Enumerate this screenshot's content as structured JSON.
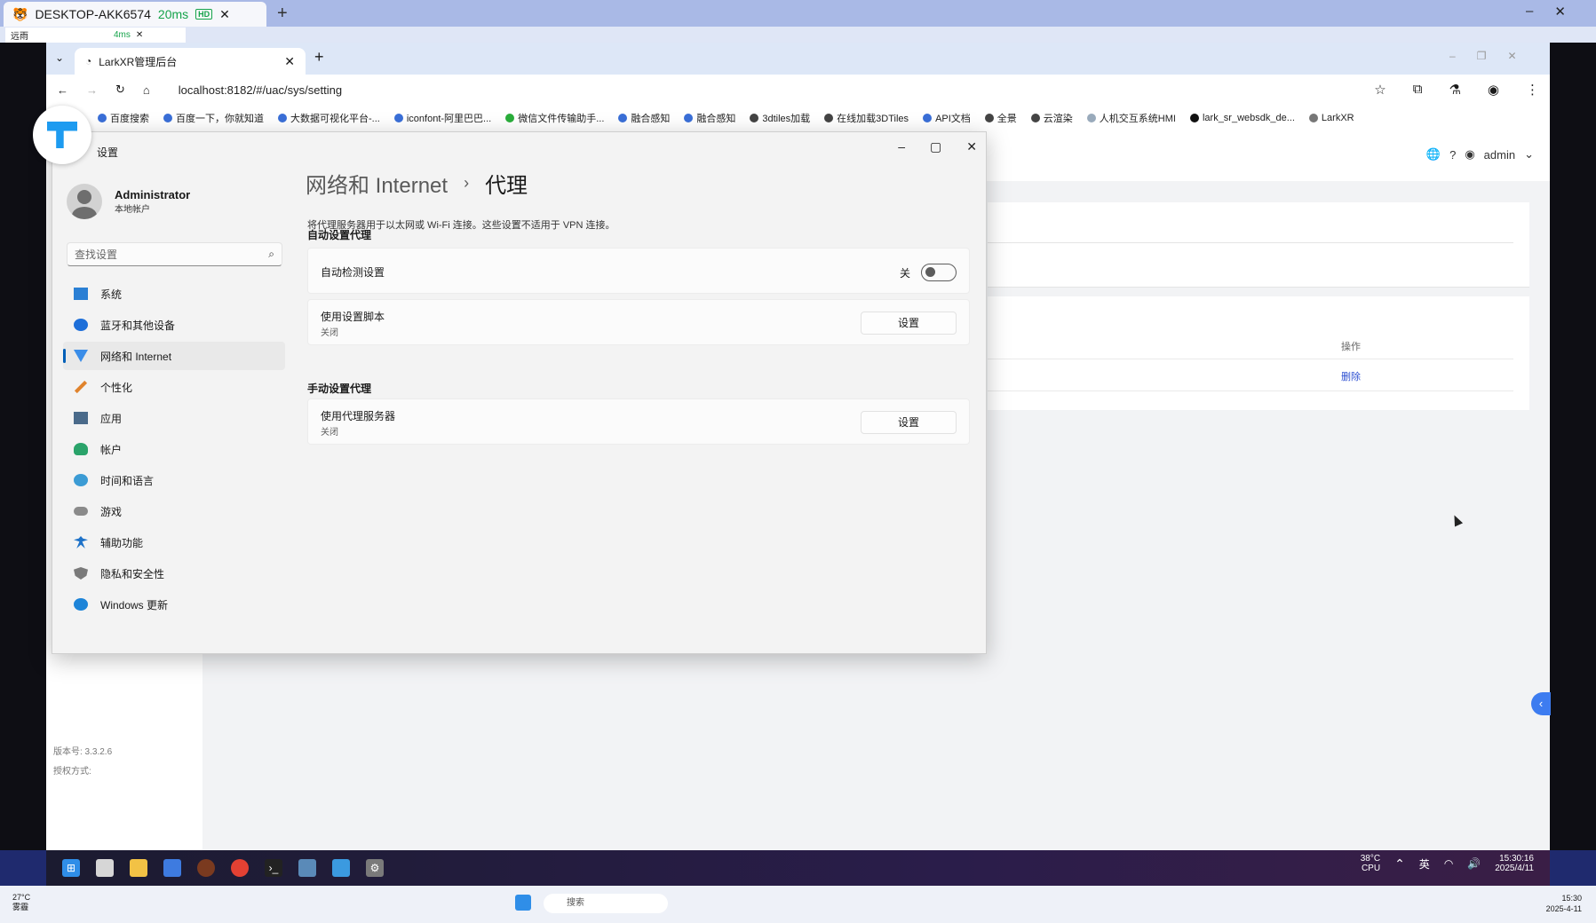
{
  "remote": {
    "host": "DESKTOP-AKK6574",
    "ping": "20ms",
    "hd": "HD",
    "inner_tab": "远雨",
    "inner_ping": "4ms"
  },
  "browser": {
    "tab_title": "LarkXR管理后台",
    "url": "localhost:8182/#/uac/sys/setting",
    "bookmarks": [
      "百度搜索",
      "百度一下，你就知道",
      "大数据可视化平台-...",
      "iconfont-阿里巴巴...",
      "微信文件传输助手...",
      "融合感知",
      "融合感知",
      "3dtiles加载",
      "在线加载3DTiles",
      "API文档",
      "全景",
      "云渲染",
      "人机交互系统HMI",
      "lark_sr_websdk_de...",
      "LarkXR"
    ]
  },
  "page": {
    "user": "admin",
    "col_op": "操作",
    "delete": "删除",
    "version": "版本号: 3.3.2.6",
    "license": "授权方式:"
  },
  "settings": {
    "title": "设置",
    "user_name": "Administrator",
    "user_type": "本地帐户",
    "search_placeholder": "查找设置",
    "nav": [
      "系统",
      "蓝牙和其他设备",
      "网络和 Internet",
      "个性化",
      "应用",
      "帐户",
      "时间和语言",
      "游戏",
      "辅助功能",
      "隐私和安全性",
      "Windows 更新"
    ],
    "crumb_parent": "网络和 Internet",
    "crumb_current": "代理",
    "description": "将代理服务器用于以太网或 Wi-Fi 连接。这些设置不适用于 VPN 连接。",
    "auto_section": "自动设置代理",
    "auto_detect": "自动检测设置",
    "auto_detect_state": "关",
    "script_label": "使用设置脚本",
    "script_state": "关闭",
    "setup_btn": "设置",
    "manual_section": "手动设置代理",
    "proxy_label": "使用代理服务器",
    "proxy_state": "关闭"
  },
  "taskbar": {
    "cpu_temp": "38°C",
    "cpu": "CPU",
    "ime": "英",
    "time": "15:30:16",
    "date": "2025/4/11",
    "weather_temp": "27°C",
    "weather": "雾霾",
    "search": "搜索",
    "outer_time": "15:30",
    "outer_date": "2025-4-11"
  },
  "colors": {
    "accent": "#005fb8",
    "link": "#2d4fd1"
  }
}
